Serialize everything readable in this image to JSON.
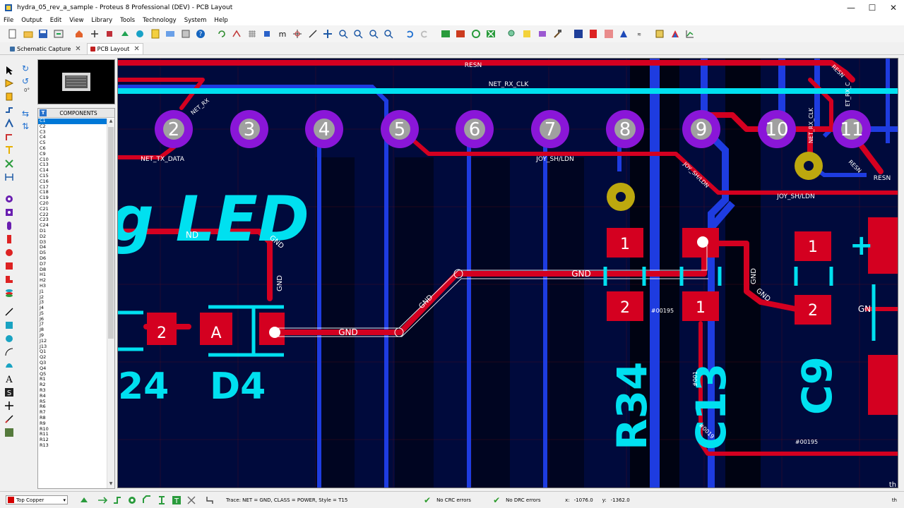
{
  "window": {
    "title": "hydra_05_rev_a_sample - Proteus 8 Professional (DEV) - PCB Layout",
    "controls": [
      "—",
      "☐",
      "✕"
    ]
  },
  "menu": [
    "File",
    "Output",
    "Edit",
    "View",
    "Library",
    "Tools",
    "Technology",
    "System",
    "Help"
  ],
  "tabs": [
    {
      "label": "Schematic Capture",
      "active": false
    },
    {
      "label": "PCB Layout",
      "active": true
    }
  ],
  "rotation": {
    "angle": "0°"
  },
  "components_panel": {
    "header": "COMPONENTS",
    "mode_button": "T",
    "items": [
      "C1",
      "C2",
      "C3",
      "C4",
      "C5",
      "C6",
      "C9",
      "C10",
      "C13",
      "C14",
      "C15",
      "C16",
      "C17",
      "C18",
      "C19",
      "C20",
      "C21",
      "C22",
      "C23",
      "C24",
      "D1",
      "D2",
      "D3",
      "D4",
      "D5",
      "D6",
      "D7",
      "D8",
      "H1",
      "H2",
      "H3",
      "J1",
      "J2",
      "J3",
      "J4",
      "J5",
      "J6",
      "J7",
      "J8",
      "J9",
      "J12",
      "J13",
      "Q1",
      "Q2",
      "Q3",
      "Q4",
      "Q5",
      "R1",
      "R2",
      "R3",
      "R4",
      "R5",
      "R6",
      "R7",
      "R8",
      "R9",
      "R10",
      "R11",
      "R12",
      "R13"
    ],
    "selected": "C1"
  },
  "pcb": {
    "big_text": "g LED",
    "pad_numbers": [
      "2",
      "3",
      "4",
      "5",
      "6",
      "7",
      "8",
      "9",
      "10",
      "11"
    ],
    "nets": {
      "resn": "RESN",
      "rx_clk": "NET_RX_CLK",
      "tx_data": "NET_TX_DATA",
      "joy": "JOY_SH/LDN",
      "gnd": "GND",
      "n195": "#00195"
    },
    "designators": [
      "24",
      "D4",
      "R34",
      "C13",
      "C9"
    ],
    "pad_labels": {
      "a": "A",
      "one": "1",
      "two": "2",
      "plus": "+"
    },
    "partial_label": "ND",
    "edge_labels": {
      "gn": "GN",
      "rx_clk_short": "NET_RX_CLK",
      "c_frag": "ET_RX_C",
      "rx_frag": "NET_RX",
      "th": "th",
      "n0": "#001",
      "n0b": "#0019"
    }
  },
  "status": {
    "layer": "Top Copper",
    "trace_info": "Trace: NET = GND, CLASS = POWER, Style = T15",
    "crc": "No CRC errors",
    "drc": "No DRC errors",
    "x_label": "x:",
    "x_value": "-1076.0",
    "y_label": "y:",
    "y_value": "-1362.0",
    "unit": "th"
  },
  "colors": {
    "board": "#000a3c",
    "copper_top": "#d40020",
    "copper_bottom": "#1e3ce0",
    "silk": "#00e0f0",
    "pad_through": "#8a16d8",
    "via": "#bda80e"
  }
}
